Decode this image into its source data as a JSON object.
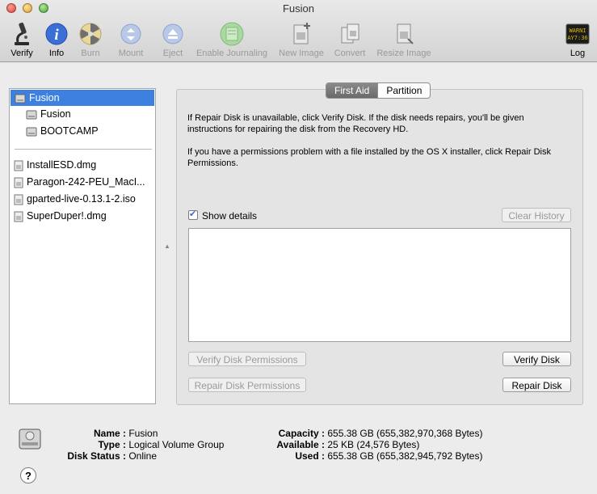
{
  "window": {
    "title": "Fusion"
  },
  "toolbar": {
    "verify": "Verify",
    "info": "Info",
    "burn": "Burn",
    "mount": "Mount",
    "eject": "Eject",
    "enable_journaling": "Enable Journaling",
    "new_image": "New Image",
    "convert": "Convert",
    "resize_image": "Resize Image",
    "log": "Log",
    "log_icon_text_1": "WARNI",
    "log_icon_text_2": "AY7:36"
  },
  "sidebar": {
    "selected": "Fusion",
    "disks": [
      "Fusion",
      "Fusion",
      "BOOTCAMP"
    ],
    "images": [
      "InstallESD.dmg",
      "Paragon-242-PEU_MacI...",
      "gparted-live-0.13.1-2.iso",
      "SuperDuper!.dmg"
    ]
  },
  "tabs": [
    "First Aid",
    "Partition"
  ],
  "first_aid": {
    "para1": "If Repair Disk is unavailable, click Verify Disk. If the disk needs repairs, you'll be given instructions for repairing the disk from the Recovery HD.",
    "para2": "If you have a permissions problem with a file installed by the OS X installer, click Repair Disk Permissions.",
    "show_details": "Show details",
    "show_details_checked": true,
    "clear_history": "Clear History",
    "verify_permissions": "Verify Disk Permissions",
    "repair_permissions": "Repair Disk Permissions",
    "verify_disk": "Verify Disk",
    "repair_disk": "Repair Disk"
  },
  "disk_info": {
    "name_label": "Name :",
    "name": "Fusion",
    "type_label": "Type :",
    "type": "Logical Volume Group",
    "status_label": "Disk Status :",
    "status": "Online",
    "capacity_label": "Capacity :",
    "capacity": "655.38 GB (655,382,970,368 Bytes)",
    "available_label": "Available :",
    "available": "25 KB (24,576 Bytes)",
    "used_label": "Used :",
    "used": "655.38 GB (655,382,945,792 Bytes)"
  },
  "help": "?"
}
